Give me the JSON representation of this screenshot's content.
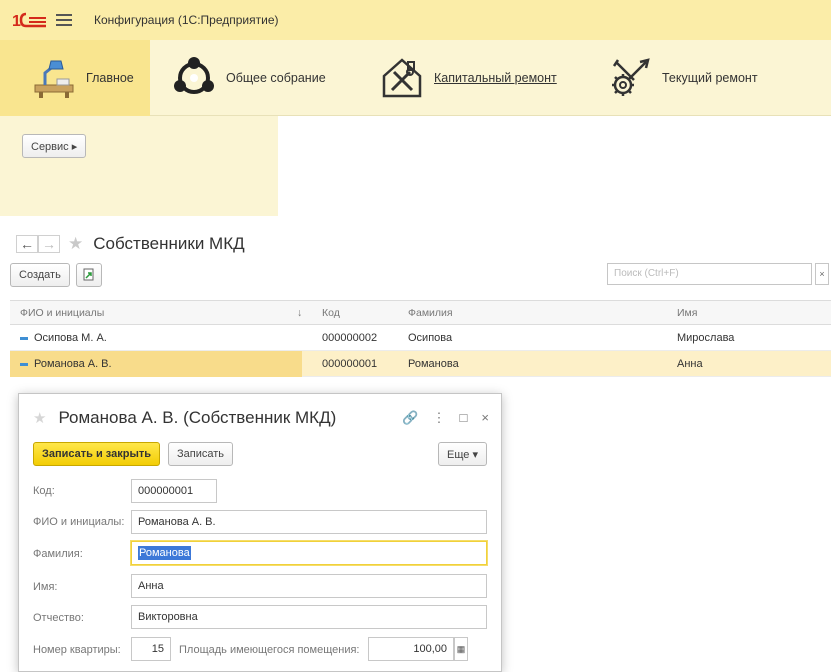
{
  "app": {
    "title": "Конфигурация  (1С:Предприятие)"
  },
  "sections": [
    {
      "label": "Главное"
    },
    {
      "label": "Общее собрание"
    },
    {
      "label": "Капитальный ремонт"
    },
    {
      "label": "Текущий ремонт"
    }
  ],
  "panel": {
    "service_label": "Сервис  ▸"
  },
  "list": {
    "title": "Собственники МКД",
    "create_label": "Создать",
    "search_placeholder": "Поиск (Ctrl+F)",
    "search_clear": "×",
    "columns": {
      "fio": "ФИО и инициалы",
      "sort": "↓",
      "code": "Код",
      "lastname": "Фамилия",
      "firstname": "Имя"
    },
    "rows": [
      {
        "fio": "Осипова М. А.",
        "code": "000000002",
        "lastname": "Осипова",
        "firstname": "Мирослава"
      },
      {
        "fio": "Романова А. В.",
        "code": "000000001",
        "lastname": "Романова",
        "firstname": "Анна"
      }
    ]
  },
  "dialog": {
    "title": "Романова А. В. (Собственник МКД)",
    "controls": {
      "link": "🔗",
      "more": "⋮",
      "max": "□",
      "close": "×"
    },
    "save_close_label": "Записать и закрыть",
    "save_label": "Записать",
    "more_label": "Еще ▾",
    "fields": {
      "code_label": "Код:",
      "code_value": "000000001",
      "fio_label": "ФИО и инициалы:",
      "fio_value": "Романова А. В.",
      "lastname_label": "Фамилия:",
      "lastname_value": "Романова",
      "firstname_label": "Имя:",
      "firstname_value": "Анна",
      "patronymic_label": "Отчество:",
      "patronymic_value": "Викторовна",
      "apartment_label": "Номер квартиры:",
      "apartment_value": "15",
      "area_label": "Площадь имеющегося помещения:",
      "area_value": "100,00"
    }
  },
  "colors": {
    "accent_yellow": "#f3cd05",
    "titlebar": "#fbeda8",
    "selected_row": "#fdf0c8"
  }
}
